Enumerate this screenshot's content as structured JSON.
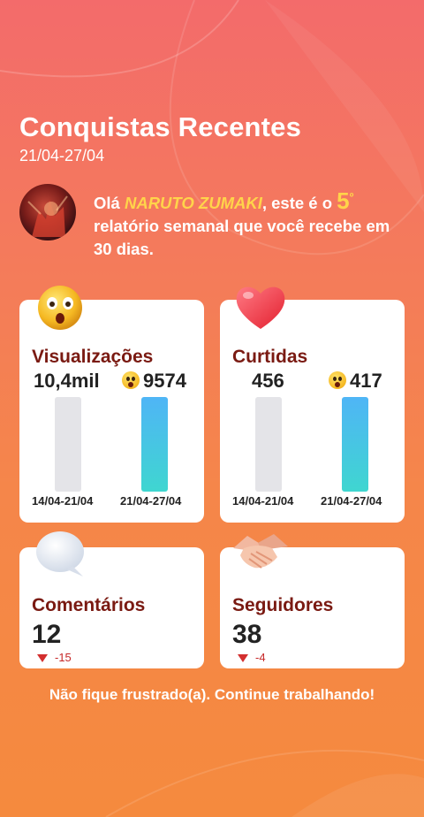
{
  "header": {
    "title": "Conquistas Recentes",
    "date_range": "21/04-27/04"
  },
  "greeting": {
    "prefix": "Olá ",
    "user_name": "NARUTO ZUMAKI",
    "middle": ", este é o ",
    "ordinal_number": "5",
    "ordinal_suffix": "º",
    "suffix": "relatório semanal que você recebe em 30 dias."
  },
  "views_card": {
    "label": "Visualizações",
    "icon": "surprised-face-icon",
    "previous_value": "10,4mil",
    "current_value": "9574",
    "previous_period": "14/04-21/04",
    "current_period": "21/04-27/04"
  },
  "likes_card": {
    "label": "Curtidas",
    "icon": "heart-icon",
    "previous_value": "456",
    "current_value": "417",
    "previous_period": "14/04-21/04",
    "current_period": "21/04-27/04"
  },
  "comments_card": {
    "label": "Comentários",
    "icon": "speech-bubble-icon",
    "value": "12",
    "delta": "-15"
  },
  "followers_card": {
    "label": "Seguidores",
    "icon": "handshake-icon",
    "value": "38",
    "delta": "-4"
  },
  "footer": {
    "message": "Não fique frustrado(a). Continue trabalhando!"
  },
  "colors": {
    "label_color": "#7a1a12",
    "name_highlight": "#ffd44a",
    "negative": "#d32f2f",
    "bar_current": "#3fd6d0",
    "bar_previous": "#e4e4e8"
  }
}
